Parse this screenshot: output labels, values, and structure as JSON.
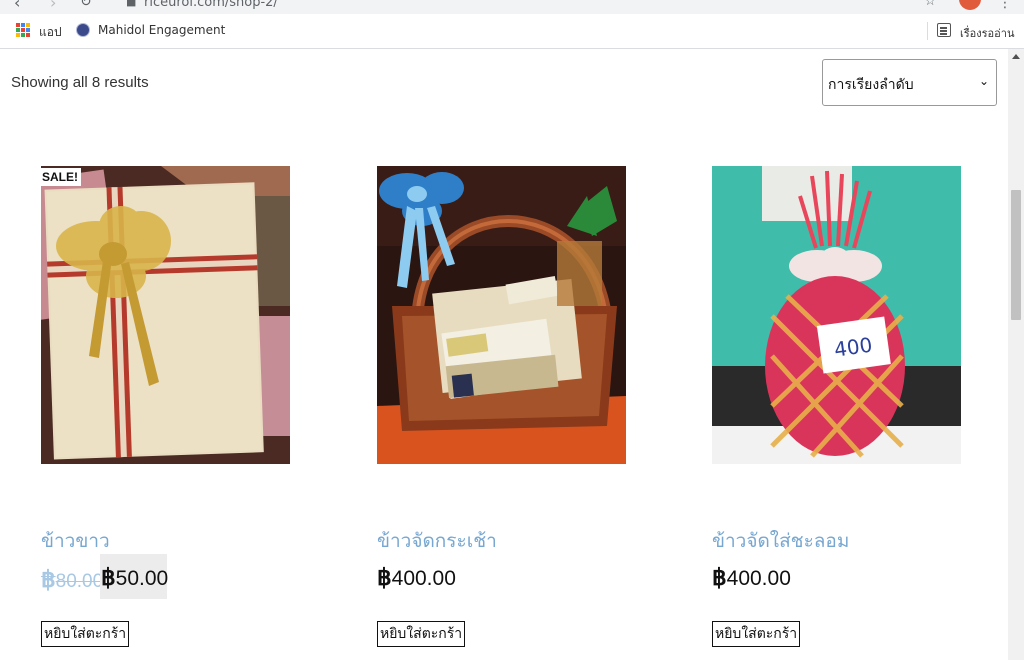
{
  "browser": {
    "url": "riceuroi.com/shop-2/",
    "bookmarks": [
      {
        "label": "แอป",
        "icon": "apps-grid-icon"
      },
      {
        "label": "Mahidol Engagement",
        "icon": "mahidol-logo-icon"
      }
    ],
    "reading_list_label": "เรื่องรออ่าน"
  },
  "shop": {
    "result_count": "Showing all 8 results",
    "orderby": {
      "selected": "การเรียงลำดับ"
    },
    "products": [
      {
        "title": "ข้าวขาว",
        "sale_badge": "SALE!",
        "old_price_symbol": "฿",
        "old_price": "80.00",
        "price_symbol": "฿",
        "price": "50.00",
        "button": "หยิบใส่ตะกร้า"
      },
      {
        "title": "ข้าวจัดกระเช้า",
        "price_symbol": "฿",
        "price": "400.00",
        "button": "หยิบใส่ตะกร้า"
      },
      {
        "title": "ข้าวจัดใส่ชะลอม",
        "price_symbol": "฿",
        "price": "400.00",
        "button": "หยิบใส่ตะกร้า",
        "tag_label": "400"
      }
    ]
  },
  "colors": {
    "title_link": "#77a7d1",
    "old_price": "#a8c8e4",
    "sale_bg": "#ececec"
  }
}
